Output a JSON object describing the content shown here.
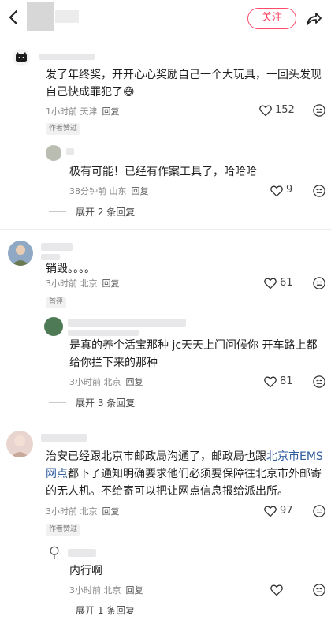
{
  "header": {
    "follow_label": "关注"
  },
  "threads": [
    {
      "text1": "发了年终奖，开开心心奖励自己一个大玩具，一回头发现",
      "text2": "自己快成罪犯了😅",
      "meta": "1小时前 天津",
      "reply": "回复",
      "likes": "152",
      "badge": "作者赞过",
      "sub": {
        "text": "极有可能！已经有作案工具了，哈哈哈",
        "meta": "38分钟前 山东",
        "reply": "回复",
        "likes": "9"
      },
      "expand": "展开 2 条回复"
    },
    {
      "text1": "销毁。。。。",
      "meta": "3小时前 北京",
      "reply": "回复",
      "likes": "61",
      "badge": "首评",
      "sub": {
        "text1": "是真的养个活宝那种  jc天天上门问候你 开车路上都",
        "text2": "给你拦下来的那种",
        "meta": "3小时前 北京",
        "reply": "回复",
        "likes": "81"
      },
      "expand": "展开 3 条回复"
    },
    {
      "text1a": "治安已经跟北京市邮政局沟通了，邮政局也跟",
      "link1": "北京市EMS",
      "link2": "网点",
      "text2b": "都下了通知明确要求他们必须要保障往北京市外邮寄",
      "text3": "的无人机。不给寄可以把让网点信息报给派出所。",
      "meta": "3小时前 北京",
      "reply": "回复",
      "likes": "97",
      "badge": "作者赞过",
      "sub": {
        "text": "内行啊",
        "meta": "3小时前 北京",
        "reply": "回复"
      },
      "expand": "展开 1 条回复"
    }
  ]
}
